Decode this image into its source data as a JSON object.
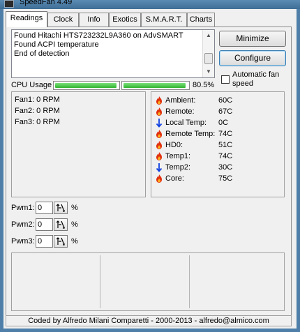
{
  "window": {
    "title": "SpeedFan 4.49"
  },
  "tabs": [
    {
      "label": "Readings",
      "active": true
    },
    {
      "label": "Clock"
    },
    {
      "label": "Info"
    },
    {
      "label": "Exotics"
    },
    {
      "label": "S.M.A.R.T."
    },
    {
      "label": "Charts"
    }
  ],
  "log": {
    "lines": [
      "Found Hitachi HTS723232L9A360 on AdvSMART",
      "Found ACPI temperature",
      "End of detection"
    ]
  },
  "buttons": {
    "minimize": "Minimize",
    "configure": "Configure"
  },
  "auto_fan": {
    "label": "Automatic fan speed",
    "checked": false
  },
  "cpu": {
    "label": "CPU Usage",
    "percent_text": "80.5%",
    "bar1_fraction": 0.98,
    "bar2_fraction": 0.97
  },
  "fans": [
    {
      "label": "Fan1: 0 RPM"
    },
    {
      "label": "Fan2: 0 RPM"
    },
    {
      "label": "Fan3: 0 RPM"
    }
  ],
  "temps": [
    {
      "label": "Ambient:",
      "value": "60C",
      "icon": "flame-icon"
    },
    {
      "label": "Remote:",
      "value": "67C",
      "icon": "flame-icon"
    },
    {
      "label": "Local Temp:",
      "value": "0C",
      "icon": "arrow-down-icon"
    },
    {
      "label": "Remote Temp:",
      "value": "74C",
      "icon": "flame-icon"
    },
    {
      "label": "HD0:",
      "value": "51C",
      "icon": "flame-icon"
    },
    {
      "label": "Temp1:",
      "value": "74C",
      "icon": "flame-icon"
    },
    {
      "label": "Temp2:",
      "value": "30C",
      "icon": "arrow-down-icon"
    },
    {
      "label": "Core:",
      "value": "75C",
      "icon": "flame-icon"
    }
  ],
  "pwm": [
    {
      "label": "Pwm1:",
      "value": "0",
      "unit": "%"
    },
    {
      "label": "Pwm2:",
      "value": "0",
      "unit": "%"
    },
    {
      "label": "Pwm3:",
      "value": "0",
      "unit": "%"
    }
  ],
  "status": {
    "text": "Coded by Alfredo Milani Comparetti - 2000-2013 - alfredo@almico.com"
  },
  "colors": {
    "flame": "#e03010",
    "arrow": "#1040e0",
    "bar_fill": "#3cc03c"
  }
}
